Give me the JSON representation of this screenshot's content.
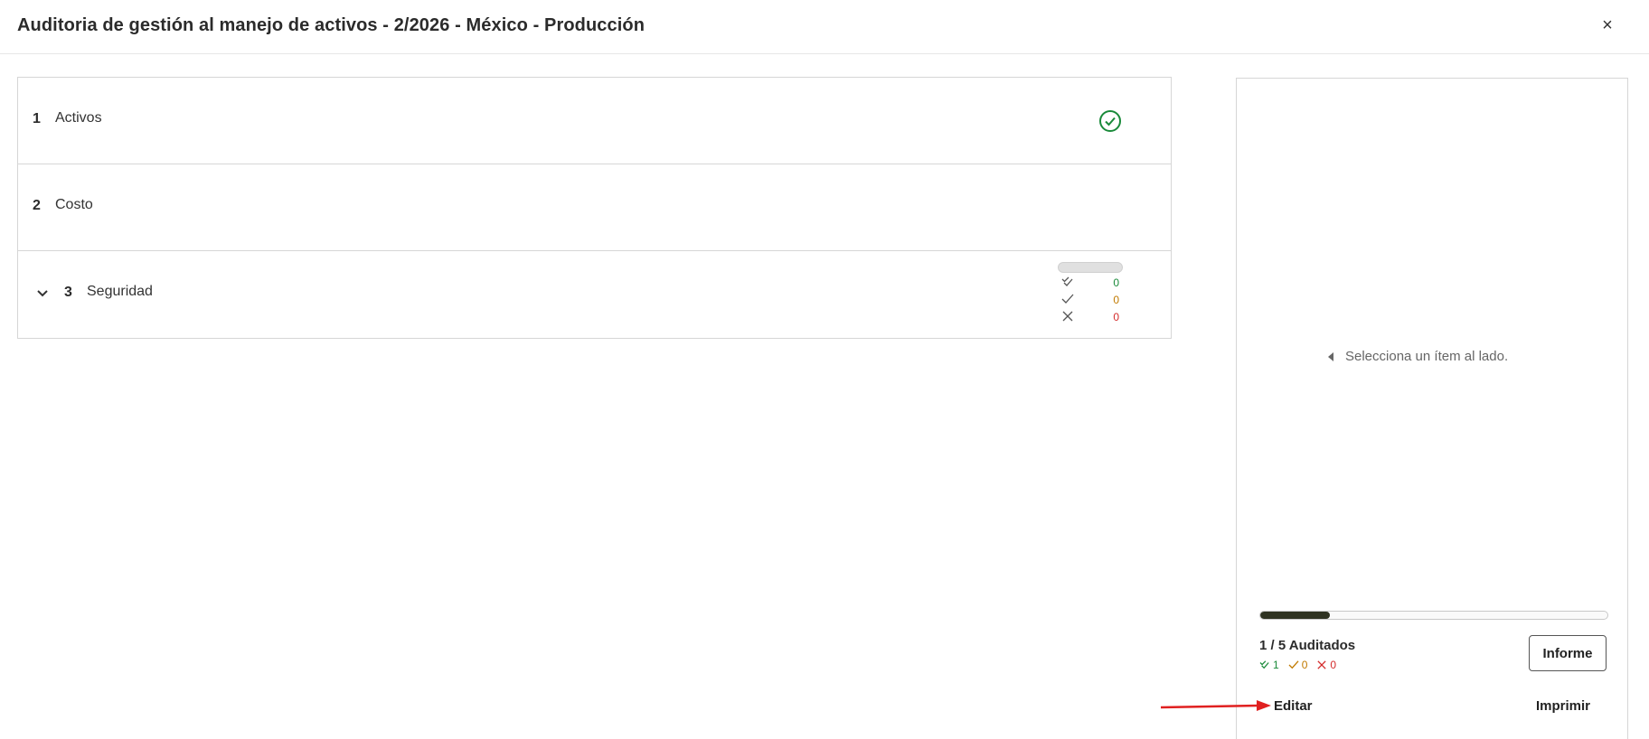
{
  "header": {
    "title": "Auditoria de gestión al manejo de activos - 2/2026 - México - Producción",
    "close_label": "×"
  },
  "sections": [
    {
      "number": "1",
      "label": "Activos",
      "status": "complete-check-icon"
    },
    {
      "number": "2",
      "label": "Costo"
    },
    {
      "number": "3",
      "label": "Seguridad",
      "expanded": true,
      "stats": {
        "double_check": "0",
        "check": "0",
        "cross": "0"
      }
    }
  ],
  "panel": {
    "hint": "Selecciona un ítem al lado.",
    "progress": {
      "done": 1,
      "total": 5,
      "fraction": 0.2
    },
    "audited_label": "1 / 5 Auditados",
    "counts": {
      "double_check": "1",
      "check": "0",
      "cross": "0"
    },
    "report_button": "Informe",
    "edit_link": "Editar",
    "print_link": "Imprimir"
  },
  "colors": {
    "green": "#1a8a3a",
    "orange": "#c17a00",
    "red": "#d42b2b",
    "arrow_red": "#e02020",
    "progress_fill": "#2f3322"
  }
}
